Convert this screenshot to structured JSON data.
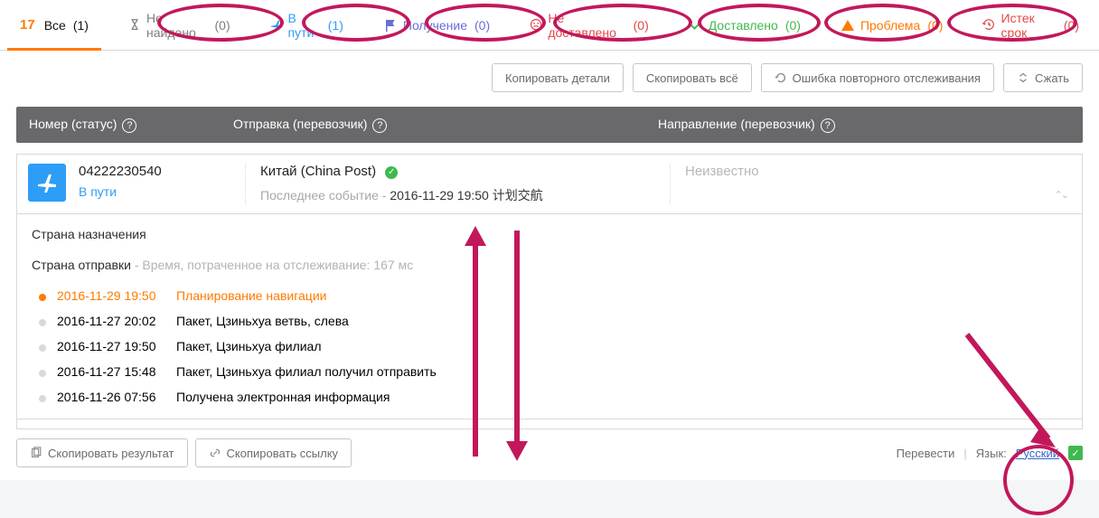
{
  "tabs": [
    {
      "key": "all",
      "label": "Все",
      "count": "(1)",
      "color": "#111"
    },
    {
      "key": "notfound",
      "label": "Не найдено",
      "count": "(0)",
      "color": "#7d7d7d"
    },
    {
      "key": "transit",
      "label": "В пути",
      "count": "(1)",
      "color": "#2e9df7"
    },
    {
      "key": "pickup",
      "label": "Получение",
      "count": "(0)",
      "color": "#6a6cd8"
    },
    {
      "key": "undelivered",
      "label": "Не доставлено",
      "count": "(0)",
      "color": "#e34848"
    },
    {
      "key": "delivered",
      "label": "Доставлено",
      "count": "(0)",
      "color": "#3fb94f"
    },
    {
      "key": "alert",
      "label": "Проблема",
      "count": "(0)",
      "color": "#ff7a00"
    },
    {
      "key": "expired",
      "label": "Истек срок",
      "count": "(0)",
      "color": "#e34848"
    }
  ],
  "toolbar": {
    "copy_details": "Копировать детали",
    "copy_all": "Скопировать всё",
    "retry_error": "Ошибка повторного отслеживания",
    "collapse": "Сжать"
  },
  "cols": {
    "number": "Номер (статус)",
    "shipping": "Отправка (перевозчик)",
    "direction": "Направление (перевозчик)"
  },
  "row": {
    "tracking_number": "04222230540",
    "status": "В пути",
    "carrier": "Китай (China Post)",
    "last_event_label": "Последнее событие -",
    "last_event_value": "2016-11-29 19:50 计划交航",
    "destination": "Неизвестно"
  },
  "detail": {
    "dest_label": "Страна назначения",
    "origin_label": "Страна отправки",
    "origin_hint": " - Время, потраченное на отслеживание: 167 мс",
    "events": [
      {
        "dt": "2016-11-29 19:50",
        "txt": "Планирование навигации"
      },
      {
        "dt": "2016-11-27 20:02",
        "txt": "Пакет, Цзиньхуа ветвь, слева"
      },
      {
        "dt": "2016-11-27 19:50",
        "txt": "Пакет, Цзиньхуа филиал"
      },
      {
        "dt": "2016-11-27 15:48",
        "txt": "Пакет, Цзиньхуа филиал получил отправить"
      },
      {
        "dt": "2016-11-26 07:56",
        "txt": "Получена электронная информация"
      }
    ]
  },
  "footer": {
    "copy_result": "Скопировать результат",
    "copy_link": "Скопировать ссылку",
    "translate": "Перевести",
    "language_label": "Язык:",
    "language": "Русский"
  }
}
